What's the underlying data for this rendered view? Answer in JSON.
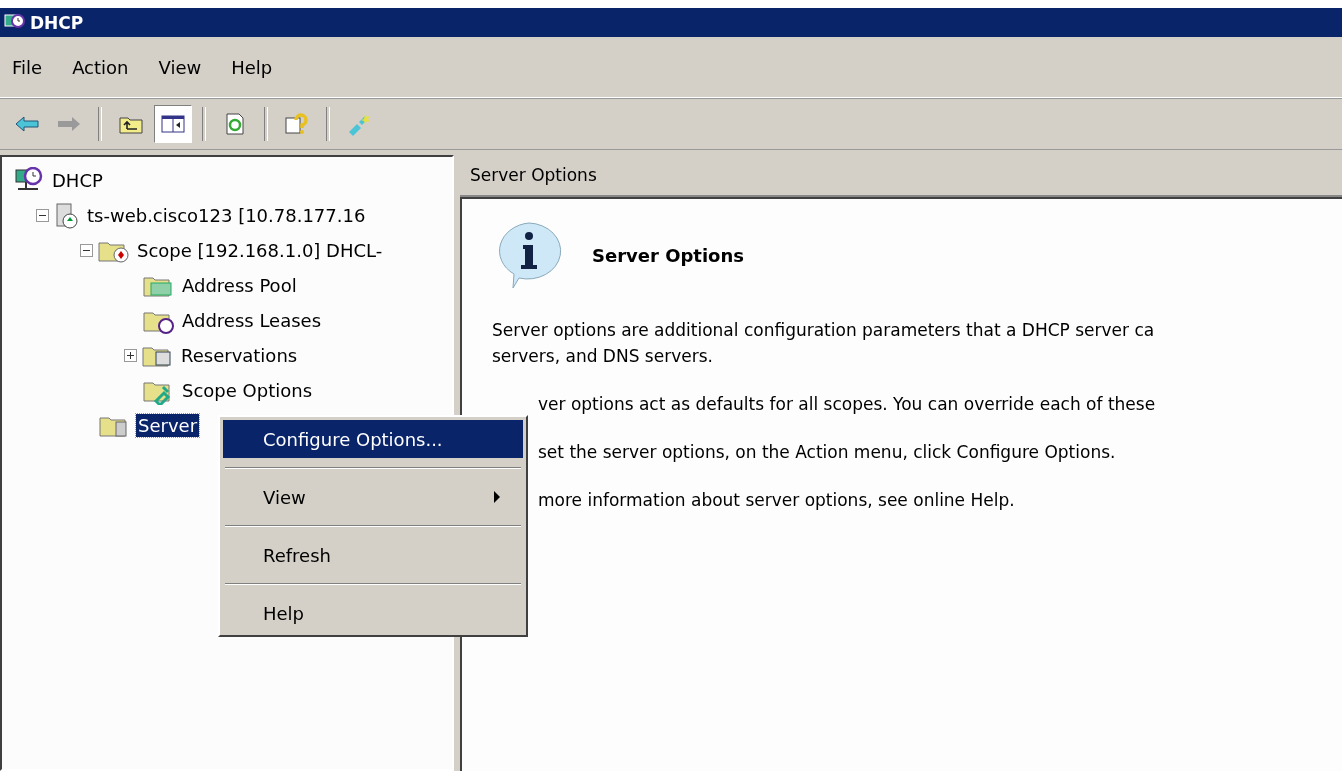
{
  "window": {
    "title": "DHCP"
  },
  "menu_bar": [
    {
      "label": "File"
    },
    {
      "label": "Action"
    },
    {
      "label": "View"
    },
    {
      "label": "Help"
    }
  ],
  "toolbar": [
    {
      "kind": "back",
      "pressed": false
    },
    {
      "kind": "forward",
      "pressed": false
    },
    {
      "kind": "separator"
    },
    {
      "kind": "up",
      "pressed": false
    },
    {
      "kind": "tree",
      "pressed": true
    },
    {
      "kind": "separator"
    },
    {
      "kind": "refresh",
      "pressed": false
    },
    {
      "kind": "separator"
    },
    {
      "kind": "help",
      "pressed": false
    },
    {
      "kind": "separator"
    },
    {
      "kind": "action",
      "pressed": false
    }
  ],
  "tree": {
    "items": [
      {
        "label": "DHCP",
        "kind": "root",
        "selected": false,
        "children": [
          {
            "label": "ts-web.cisco123 [10.78.177.16",
            "kind": "server",
            "expanded": true,
            "selected": false,
            "children": [
              {
                "label": "Scope [192.168.1.0] DHCL-",
                "kind": "scope",
                "expanded": true,
                "selected": false,
                "children": [
                  {
                    "label": "Address Pool",
                    "kind": "pool",
                    "selected": false
                  },
                  {
                    "label": "Address Leases",
                    "kind": "leases",
                    "selected": false
                  },
                  {
                    "label": "Reservations",
                    "kind": "reservations",
                    "expanded": false,
                    "selected": false
                  },
                  {
                    "label": "Scope Options",
                    "kind": "options",
                    "selected": false
                  }
                ]
              },
              {
                "label": "Server",
                "kind": "server-options",
                "selected": true
              }
            ]
          }
        ]
      }
    ]
  },
  "details": {
    "header": "Server Options",
    "title": "Server Options",
    "paragraphs": [
      {
        "lines": [
          "Server options are additional configuration parameters that a DHCP server ca",
          "servers, and DNS servers."
        ],
        "covered": false
      },
      {
        "lines": [
          "ver options act as defaults for all scopes.  You can override each of these"
        ],
        "covered": true
      },
      {
        "lines": [
          "set the server options, on the Action menu, click Configure Options."
        ],
        "covered": true
      },
      {
        "lines": [
          "more information about server options, see online Help."
        ],
        "covered": true
      }
    ]
  },
  "context_menu": [
    {
      "label": "Configure Options...",
      "selected": true,
      "submenu": false
    },
    {
      "label": "View",
      "selected": false,
      "submenu": true
    },
    {
      "label": "Refresh",
      "selected": false,
      "submenu": false
    },
    {
      "label": "Help",
      "selected": false,
      "submenu": false
    }
  ]
}
